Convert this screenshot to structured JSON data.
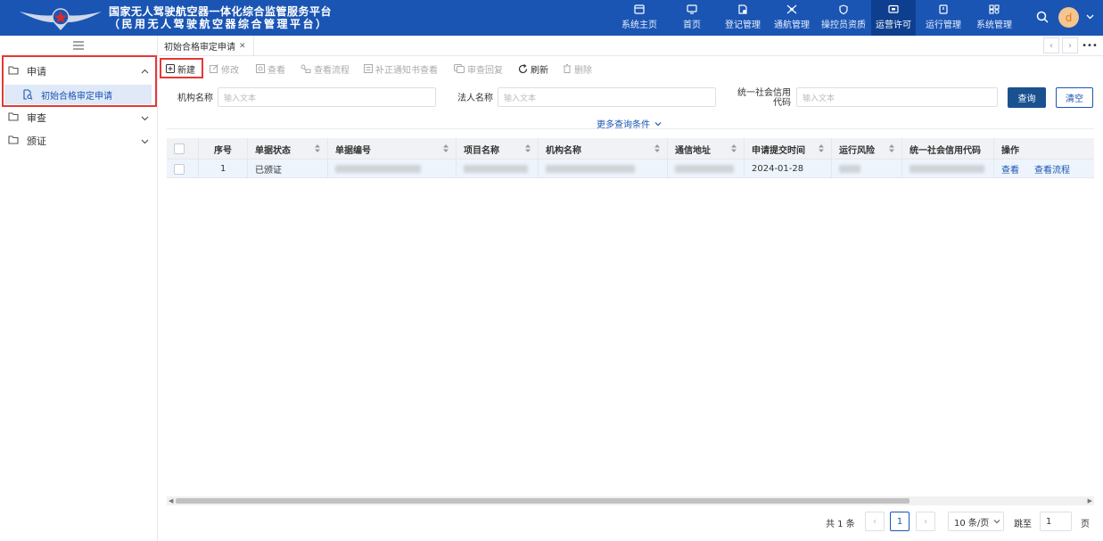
{
  "header": {
    "title_line1": "国家无人驾驶航空器一体化综合监管服务平台",
    "title_line2": "（民用无人驾驶航空器综合管理平台）",
    "nav": [
      {
        "label": "系统主页",
        "icon": "home-window-icon"
      },
      {
        "label": "首页",
        "icon": "monitor-icon"
      },
      {
        "label": "登记管理",
        "icon": "register-doc-icon"
      },
      {
        "label": "通航管理",
        "icon": "drone-icon"
      },
      {
        "label": "操控员资质",
        "icon": "shield-icon"
      },
      {
        "label": "运营许可",
        "icon": "license-icon",
        "active": true
      },
      {
        "label": "运行管理",
        "icon": "operation-icon"
      },
      {
        "label": "系统管理",
        "icon": "settings-icon"
      }
    ],
    "avatar_letter": "d"
  },
  "sidebar": {
    "groups": [
      {
        "label": "申请",
        "expanded": true,
        "children": [
          {
            "label": "初始合格审定申请",
            "active": true
          }
        ]
      },
      {
        "label": "审查",
        "expanded": false
      },
      {
        "label": "颁证",
        "expanded": false
      }
    ]
  },
  "tabs": [
    {
      "label": "初始合格审定申请"
    }
  ],
  "toolbar": {
    "new": "新建",
    "edit": "修改",
    "view": "查看",
    "view_flow": "查看流程",
    "notice": "补正通知书查看",
    "review_reply": "审查回复",
    "refresh": "刷新",
    "delete": "删除"
  },
  "filters": {
    "org_name_label": "机构名称",
    "org_name_placeholder": "输入文本",
    "legal_name_label": "法人名称",
    "legal_name_placeholder": "输入文本",
    "credit_code_label_1": "统一社会信用",
    "credit_code_label_2": "代码",
    "credit_code_placeholder": "输入文本",
    "query": "查询",
    "clear": "清空",
    "more": "更多查询条件"
  },
  "table": {
    "columns": [
      "序号",
      "单据状态",
      "单据编号",
      "项目名称",
      "机构名称",
      "通信地址",
      "申请提交时间",
      "运行风险",
      "统一社会信用代码",
      "操作"
    ],
    "rows": [
      {
        "index": "1",
        "status": "已颁证",
        "submit_time": "2024-01-28",
        "action_view": "查看",
        "action_flow": "查看流程"
      }
    ]
  },
  "pagination": {
    "total": "共 1 条",
    "current": "1",
    "page_size": "10 条/页",
    "jump_label": "跳至",
    "jump_value": "1",
    "page_unit": "页"
  }
}
